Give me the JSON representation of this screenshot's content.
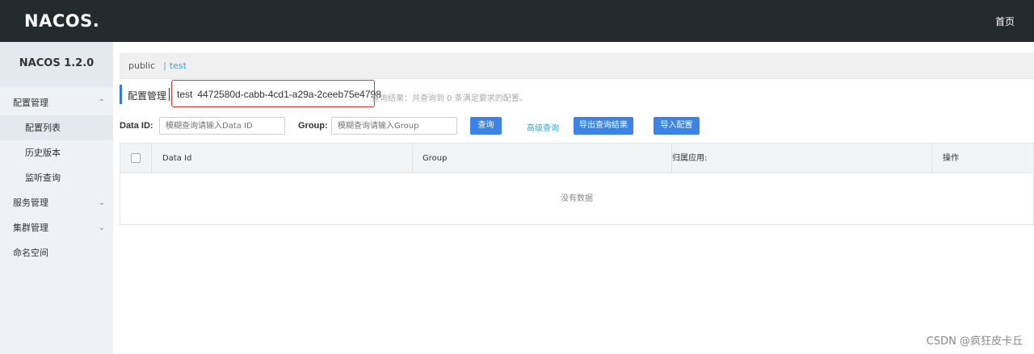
{
  "header": {
    "logo": "NACOS.",
    "home_link": "首页"
  },
  "sidebar": {
    "version": "NACOS 1.2.0",
    "items": [
      {
        "label": "配置管理",
        "chevron": "^"
      },
      {
        "label": "配置列表"
      },
      {
        "label": "历史版本"
      },
      {
        "label": "监听查询"
      },
      {
        "label": "服务管理",
        "chevron": "v"
      },
      {
        "label": "集群管理",
        "chevron": "v"
      },
      {
        "label": "命名空间"
      }
    ]
  },
  "namespace_bar": {
    "public": "public",
    "separator": "|",
    "test": "test"
  },
  "title_row": {
    "title": "配置管理",
    "separator": "|",
    "namespace_name": "test",
    "namespace_id": "4472580d-cabb-4cd1-a29a-2ceeb75e4798",
    "query_result": "查询结果：共查询到 0 条满足要求的配置。"
  },
  "filter": {
    "data_id_label": "Data ID:",
    "data_id_placeholder": "模糊查询请输入Data ID",
    "group_label": "Group:",
    "group_placeholder": "模糊查询请输入Group",
    "search_button": "查询",
    "advanced_link": "高级查询",
    "export_button": "导出查询结果",
    "import_button": "导入配置"
  },
  "table": {
    "columns": [
      "Data Id",
      "Group",
      "归属应用:",
      "操作"
    ],
    "empty_text": "没有数据"
  },
  "watermark": "CSDN @疯狂皮卡丘"
}
